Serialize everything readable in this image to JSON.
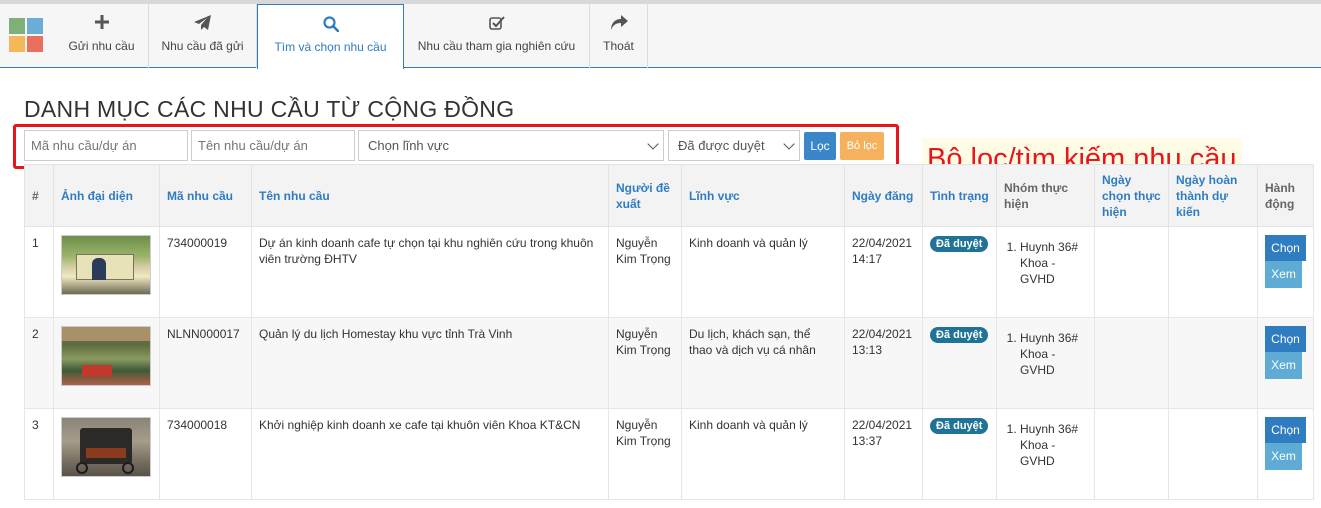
{
  "nav": {
    "items": [
      {
        "icon": "plus-icon",
        "label": "Gửi nhu cầu"
      },
      {
        "icon": "paper-plane-icon",
        "label": "Nhu cầu đã gửi"
      },
      {
        "icon": "search-icon",
        "label": "Tìm và chọn nhu cầu"
      },
      {
        "icon": "check-square-icon",
        "label": "Nhu cầu tham gia nghiên cứu"
      },
      {
        "icon": "share-icon",
        "label": "Thoát"
      }
    ],
    "active_index": 2
  },
  "page": {
    "title": "DANH MỤC CÁC NHU CẦU TỪ CỘNG ĐỒNG",
    "annotation": "Bộ lọc/tìm kiếm nhu cầu"
  },
  "filters": {
    "code_placeholder": "Mã nhu cầu/dự án",
    "name_placeholder": "Tên nhu cầu/dự án",
    "field_select": "Chọn lĩnh vực",
    "status_select": "Đã được duyệt",
    "filter_button": "Lọc",
    "clear_button": "Bỏ lọc"
  },
  "table": {
    "headers": [
      "#",
      "Ảnh đại diện",
      "Mã nhu cầu",
      "Tên nhu cầu",
      "Người đề xuất",
      "Lĩnh vực",
      "Ngày đăng",
      "Tình trạng",
      "Nhóm thực hiện",
      "Ngày chọn thực hiện",
      "Ngày hoàn thành dự kiến",
      "Hành động"
    ],
    "rows": [
      {
        "num": "1",
        "code": "734000019",
        "name": "Dự án kinh doanh cafe tự chọn tại khu nghiên cứu trong khuôn viên trường ĐHTV",
        "proposer": "Nguyễn Kim Trọng",
        "field": "Kinh doanh và quản lý",
        "date": "22/04/2021 14:17",
        "status": "Đã duyệt",
        "group": "Huynh 36# Khoa - GVHD",
        "choose_date": "",
        "finish_date": ""
      },
      {
        "num": "2",
        "code": "NLNN000017",
        "name": "Quản lý du lịch Homestay khu vực tỉnh Trà Vinh",
        "proposer": "Nguyễn Kim Trọng",
        "field": "Du lịch, khách sạn, thể thao và dịch vụ cá nhân",
        "date": "22/04/2021 13:13",
        "status": "Đã duyệt",
        "group": "Huynh 36# Khoa - GVHD",
        "choose_date": "",
        "finish_date": ""
      },
      {
        "num": "3",
        "code": "734000018",
        "name": "Khởi nghiệp kinh doanh xe cafe tại khuôn viên Khoa KT&CN",
        "proposer": "Nguyễn Kim Trọng",
        "field": "Kinh doanh và quản lý",
        "date": "22/04/2021 13:37",
        "status": "Đã duyệt",
        "group": "Huynh 36# Khoa - GVHD",
        "choose_date": "",
        "finish_date": ""
      }
    ],
    "choose_label": "Chọn",
    "view_label": "Xem"
  },
  "colors": {
    "accent": "#2f7cc1",
    "annotation_red": "#e8151b",
    "badge": "#1f7396",
    "clear_button": "#f5b15d"
  }
}
